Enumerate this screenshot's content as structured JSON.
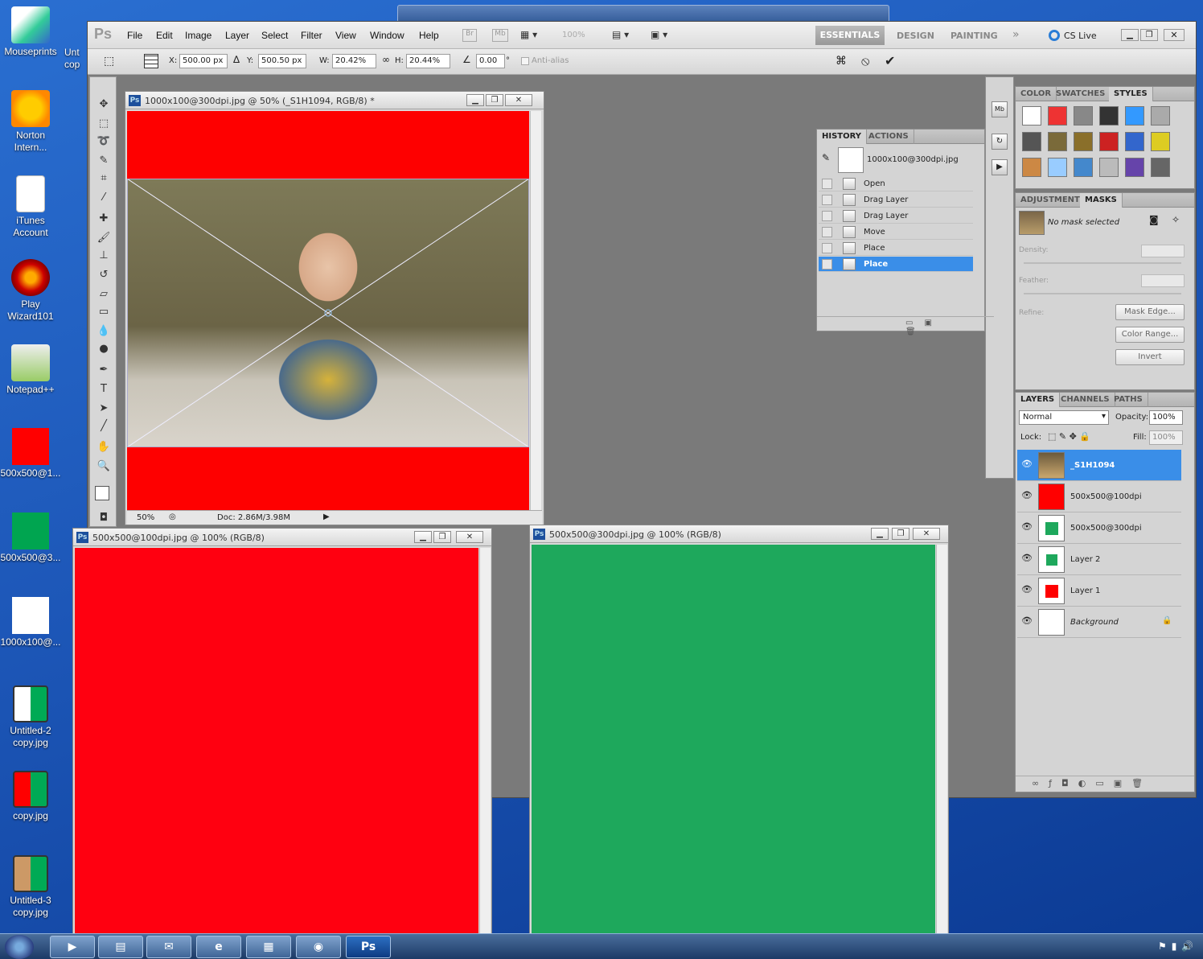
{
  "desktop": {
    "icons": [
      {
        "label": "Mouseprints",
        "icon": "mouseprints-icon"
      },
      {
        "label": "Norton Intern...",
        "icon": "norton-icon"
      },
      {
        "label": "iTunes Account",
        "icon": "document-icon"
      },
      {
        "label": "Play Wizard101",
        "icon": "wizard101-icon"
      },
      {
        "label": "Notepad++",
        "icon": "notepad-icon"
      },
      {
        "label": "500x500@1...",
        "icon": "red-image-icon"
      },
      {
        "label": "500x500@3...",
        "icon": "green-image-icon"
      },
      {
        "label": "1000x100@...",
        "icon": "white-image-icon"
      },
      {
        "label": "Untitled-2 copy.jpg",
        "icon": "image-thumb-icon"
      },
      {
        "label": "copy.jpg",
        "icon": "image-thumb-icon"
      },
      {
        "label": "Untitled-3 copy.jpg",
        "icon": "image-thumb-icon"
      }
    ],
    "partial_icon_label": "Unt cop"
  },
  "photoshop": {
    "logo": "Ps",
    "menu": [
      "File",
      "Edit",
      "Image",
      "Layer",
      "Select",
      "Filter",
      "View",
      "Window",
      "Help"
    ],
    "app_bar": {
      "br": "Br",
      "mb": "Mb",
      "zoom": "100%"
    },
    "workspaces": [
      "ESSENTIALS",
      "DESIGN",
      "PAINTING"
    ],
    "overflow": "»",
    "cs_live": "CS Live",
    "options": {
      "x_label": "X:",
      "x_value": "500.00 px",
      "y_label": "Y:",
      "y_value": "500.50 px",
      "w_label": "W:",
      "w_value": "20.42%",
      "h_label": "H:",
      "h_value": "20.44%",
      "angle_value": "0.00",
      "degree": "°",
      "antialias": "Anti-alias",
      "cancel": "⦸",
      "commit": "✔"
    },
    "documents": {
      "main": {
        "title": "1000x100@300dpi.jpg @ 50% (_S1H1094, RGB/8) *",
        "zoom": "50%",
        "doc_info": "Doc: 2.86M/3.98M",
        "colors": {
          "bar": "#fe0000"
        }
      },
      "red": {
        "title": "500x500@100dpi.jpg @ 100% (RGB/8)",
        "color": "#ff0010"
      },
      "green": {
        "title": "500x500@300dpi.jpg @ 100% (RGB/8)",
        "color": "#1ea85c"
      }
    },
    "history": {
      "tabs": [
        "HISTORY",
        "ACTIONS"
      ],
      "snapshot": "1000x100@300dpi.jpg",
      "steps": [
        "Open",
        "Drag Layer",
        "Drag Layer",
        "Move",
        "Place",
        "Place"
      ],
      "selected_index": 5
    },
    "styles_panel": {
      "tabs": [
        "COLOR",
        "SWATCHES",
        "STYLES"
      ]
    },
    "masks": {
      "tabs": [
        "ADJUSTMENTS",
        "MASKS"
      ],
      "status": "No mask selected",
      "density": "Density:",
      "feather": "Feather:",
      "refine": "Refine:",
      "buttons": [
        "Mask Edge...",
        "Color Range...",
        "Invert"
      ]
    },
    "layers": {
      "tabs": [
        "LAYERS",
        "CHANNELS",
        "PATHS"
      ],
      "blend_mode": "Normal",
      "opacity_label": "Opacity:",
      "opacity": "100%",
      "lock_label": "Lock:",
      "fill_label": "Fill:",
      "fill": "100%",
      "items": [
        {
          "name": "_S1H1094",
          "selected": true
        },
        {
          "name": "500x500@100dpi",
          "selected": false
        },
        {
          "name": "500x500@300dpi",
          "selected": false
        },
        {
          "name": "Layer 2",
          "selected": false
        },
        {
          "name": "Layer 1",
          "selected": false
        },
        {
          "name": "Background",
          "selected": false
        }
      ]
    }
  }
}
